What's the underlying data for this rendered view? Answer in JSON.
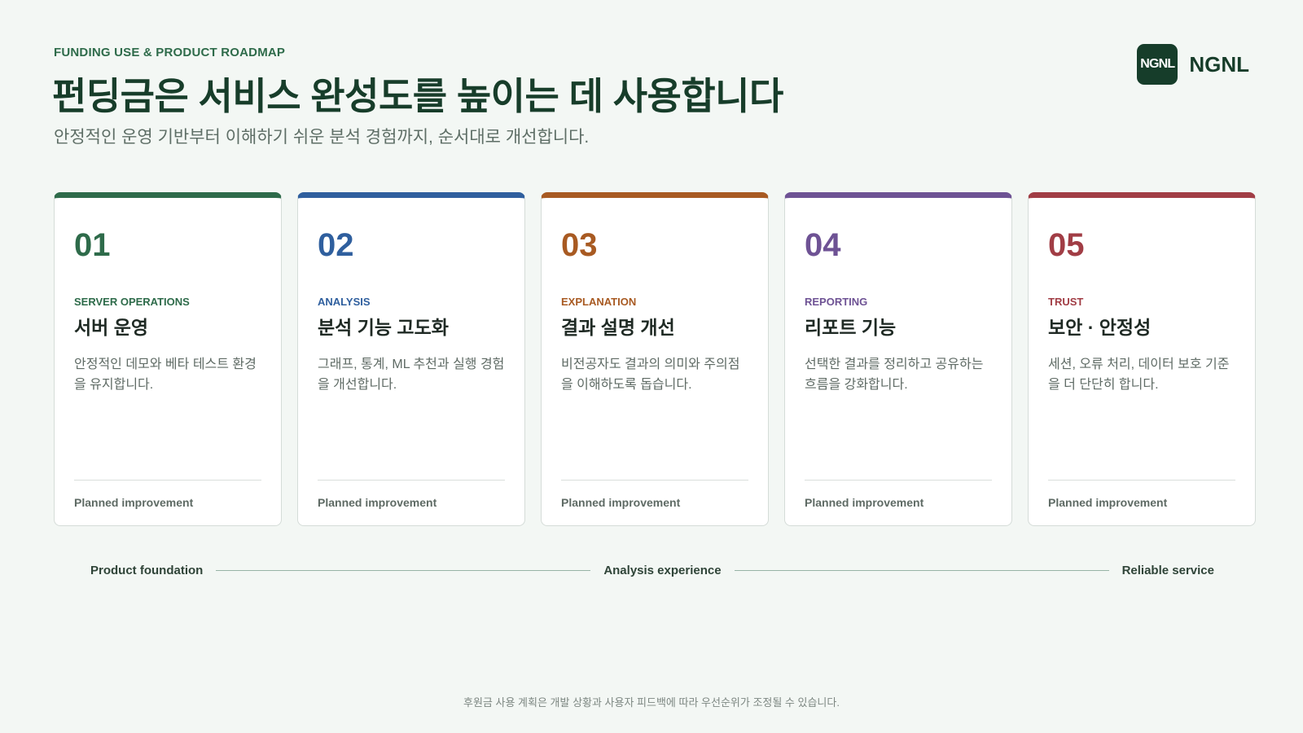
{
  "header": {
    "eyebrow": "FUNDING USE & PRODUCT ROADMAP",
    "title": "펀딩금은 서비스 완성도를 높이는 데 사용합니다",
    "subtitle": "안정적인 운영 기반부터 이해하기 쉬운 분석 경험까지, 순서대로 개선합니다."
  },
  "brand": {
    "logo_text": "NGNL",
    "name": "NGNL"
  },
  "cards": [
    {
      "number": "01",
      "category": "SERVER OPERATIONS",
      "title": "서버 운영",
      "description": "안정적인 데모와 베타 테스트 환경을 유지합니다.",
      "status": "Planned improvement",
      "accent": "#2e6b4a"
    },
    {
      "number": "02",
      "category": "ANALYSIS",
      "title": "분석 기능 고도화",
      "description": "그래프, 통계, ML 추천과 실행 경험을 개선합니다.",
      "status": "Planned improvement",
      "accent": "#2f5f9e"
    },
    {
      "number": "03",
      "category": "EXPLANATION",
      "title": "결과 설명 개선",
      "description": "비전공자도 결과의 의미와 주의점을 이해하도록 돕습니다.",
      "status": "Planned improvement",
      "accent": "#a85a22"
    },
    {
      "number": "04",
      "category": "REPORTING",
      "title": "리포트 기능",
      "description": "선택한 결과를 정리하고 공유하는 흐름을 강화합니다.",
      "status": "Planned improvement",
      "accent": "#6e5294"
    },
    {
      "number": "05",
      "category": "TRUST",
      "title": "보안 · 안정성",
      "description": "세션, 오류 처리, 데이터 보호 기준을 더 단단히 합니다.",
      "status": "Planned improvement",
      "accent": "#a13d45"
    }
  ],
  "timeline": {
    "start": "Product foundation",
    "middle": "Analysis experience",
    "end": "Reliable service"
  },
  "footnote": "후원금 사용 계획은 개발 상황과 사용자 피드백에 따라 우선순위가 조정될 수 있습니다."
}
